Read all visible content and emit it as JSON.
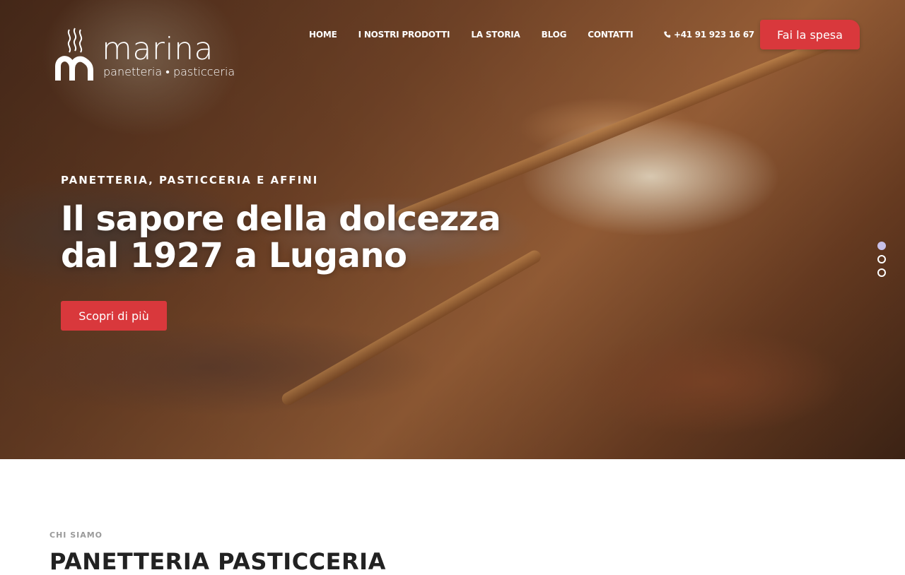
{
  "brand": {
    "name": "marina",
    "tagline": "panetteria • pasticceria",
    "logo_icon": "bread-steam-m-icon"
  },
  "nav": {
    "items": [
      {
        "label": "HOME"
      },
      {
        "label": "I NOSTRI PRODOTTI"
      },
      {
        "label": "LA STORIA"
      },
      {
        "label": "BLOG"
      },
      {
        "label": "CONTATTI"
      }
    ],
    "phone": "+41 91 923 16 67",
    "phone_icon": "phone-icon",
    "cta_label": "Fai la spesa"
  },
  "hero": {
    "eyebrow": "PANETTERIA, PASTICCERIA E AFFINI",
    "headline": "Il sapore della dolcezza dal 1927 a Lugano",
    "cta_label": "Scopri di più",
    "slides_total": 3,
    "active_slide": 1
  },
  "about": {
    "eyebrow": "CHI SIAMO",
    "title": "PANETTERIA PASTICCERIA"
  },
  "colors": {
    "accent": "#d9383c",
    "active_dot": "#c8c0e8",
    "text_light": "#ffffff",
    "text_dark": "#222222",
    "muted": "#9a9a9a"
  }
}
